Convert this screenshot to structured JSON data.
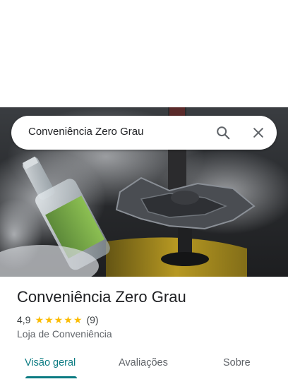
{
  "search": {
    "query": "Conveniência Zero Grau",
    "search_icon": "search-icon",
    "close_icon": "close-icon"
  },
  "hero": {
    "image": "store-photo-hookah-and-bottle"
  },
  "place": {
    "name": "Conveniência Zero Grau",
    "rating": "4,9",
    "stars": 5,
    "review_count": "(9)",
    "category": "Loja de Conveniência"
  },
  "tabs": [
    {
      "label": "Visão geral",
      "active": true
    },
    {
      "label": "Avaliações",
      "active": false
    },
    {
      "label": "Sobre",
      "active": false
    }
  ],
  "colors": {
    "accent": "#0b7b82",
    "star": "#fbbc04",
    "text_primary": "#202124",
    "text_secondary": "#5f6368"
  }
}
